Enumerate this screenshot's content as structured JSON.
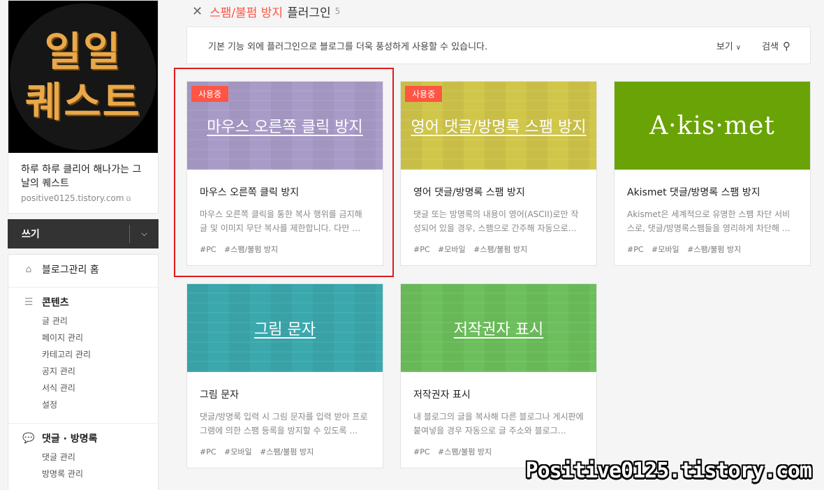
{
  "sidebar": {
    "profile_logo": "일일\n퀘스트",
    "blog_name": "하루 하루 클리어 해나가는 그 날의 퀘스트",
    "blog_url": "positive0125.tistory.com",
    "write_label": "쓰기",
    "menu": {
      "home": "블로그관리 홈",
      "contents": "콘텐츠",
      "contents_items": [
        "글 관리",
        "페이지 관리",
        "카테고리 관리",
        "공지 관리",
        "서식 관리",
        "설정"
      ],
      "comments": "댓글 · 방명록",
      "comments_items": [
        "댓글 관리",
        "방명록 관리"
      ]
    }
  },
  "header": {
    "category": "스팸/불펌 방지",
    "suffix": "플러그인",
    "count": "5"
  },
  "info_bar": {
    "description": "기본 기능 외에 플러그인으로 블로그를 더욱 풍성하게 사용할 수 있습니다.",
    "view_label": "보기",
    "search_label": "검색"
  },
  "plugins": [
    {
      "badge": "사용중",
      "thumb_title": "마우스 오른쪽 클릭 방지",
      "name": "마우스 오른쪽 클릭 방지",
      "text": "마우스 오른쪽 클릭을 통한 복사 행위를 금지해 글 및 이미지 무단 복사를 제한합니다. 다만 …",
      "tags": [
        "#PC",
        "#스팸/불펌 방지"
      ],
      "color": "#a99bc8"
    },
    {
      "badge": "사용중",
      "thumb_title": "영어 댓글/방명록 스팸 방지",
      "name": "영어 댓글/방명록 스팸 방지",
      "text": "댓글 또는 방명록의 내용이 영어(ASCII)로만 작성되어 있을 경우, 스팸으로 간주해 자동으로…",
      "tags": [
        "#PC",
        "#모바일",
        "#스팸/불펌 방지"
      ],
      "color": "#d0c64a"
    },
    {
      "badge": "",
      "thumb_title": "A·kis·met",
      "name": "Akismet 댓글/방명록 스팸 방지",
      "text": "Akismet은 세계적으로 유명한 스팸 차단 서비스로, 댓글/방명록스팸들을 영리하게 차단해 …",
      "tags": [
        "#PC",
        "#모바일",
        "#스팸/불펌 방지"
      ],
      "color": "#6aa305"
    },
    {
      "badge": "",
      "thumb_title": "그림 문자",
      "name": "그림 문자",
      "text": "댓글/방명록 입력 시 그림 문자를 입력 받아 프로그램에 의한 스팸 등록을 방지할 수 있도록 …",
      "tags": [
        "#PC",
        "#모바일",
        "#스팸/불펌 방지"
      ],
      "color": "#3aa8ad"
    },
    {
      "badge": "",
      "thumb_title": "저작권자 표시",
      "name": "저작권자 표시",
      "text": "내 블로그의 글을 복사해 다른 블로그나 게시판에 붙여넣을 경우 자동으로 글 주소와 블로그…",
      "tags": [
        "#PC",
        "#스팸/불펌 방지"
      ],
      "color": "#6cbf5c"
    }
  ],
  "watermark": "Positive0125.tistory.com"
}
